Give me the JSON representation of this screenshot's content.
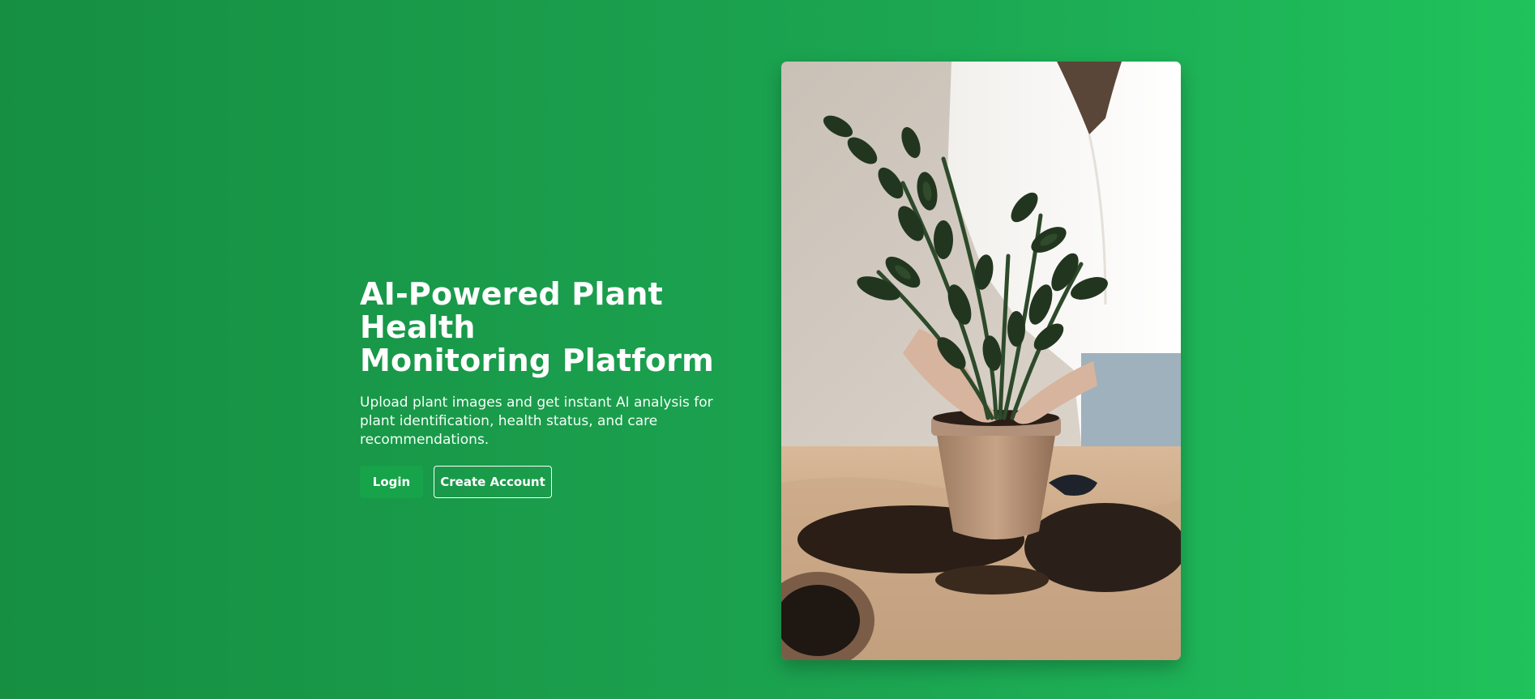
{
  "hero": {
    "title_line1": "AI-Powered Plant Health",
    "title_line2": "Monitoring Platform",
    "subtitle": "Upload plant images and get instant AI analysis for plant identification, health status, and care recommendations.",
    "login_label": "Login",
    "create_account_label": "Create Account"
  },
  "image": {
    "alt": "Person repotting a ZZ plant in a terracotta pot"
  },
  "colors": {
    "background_start": "#168f42",
    "background_end": "#20c25c",
    "login_button": "#16a34a",
    "text": "#ffffff"
  }
}
